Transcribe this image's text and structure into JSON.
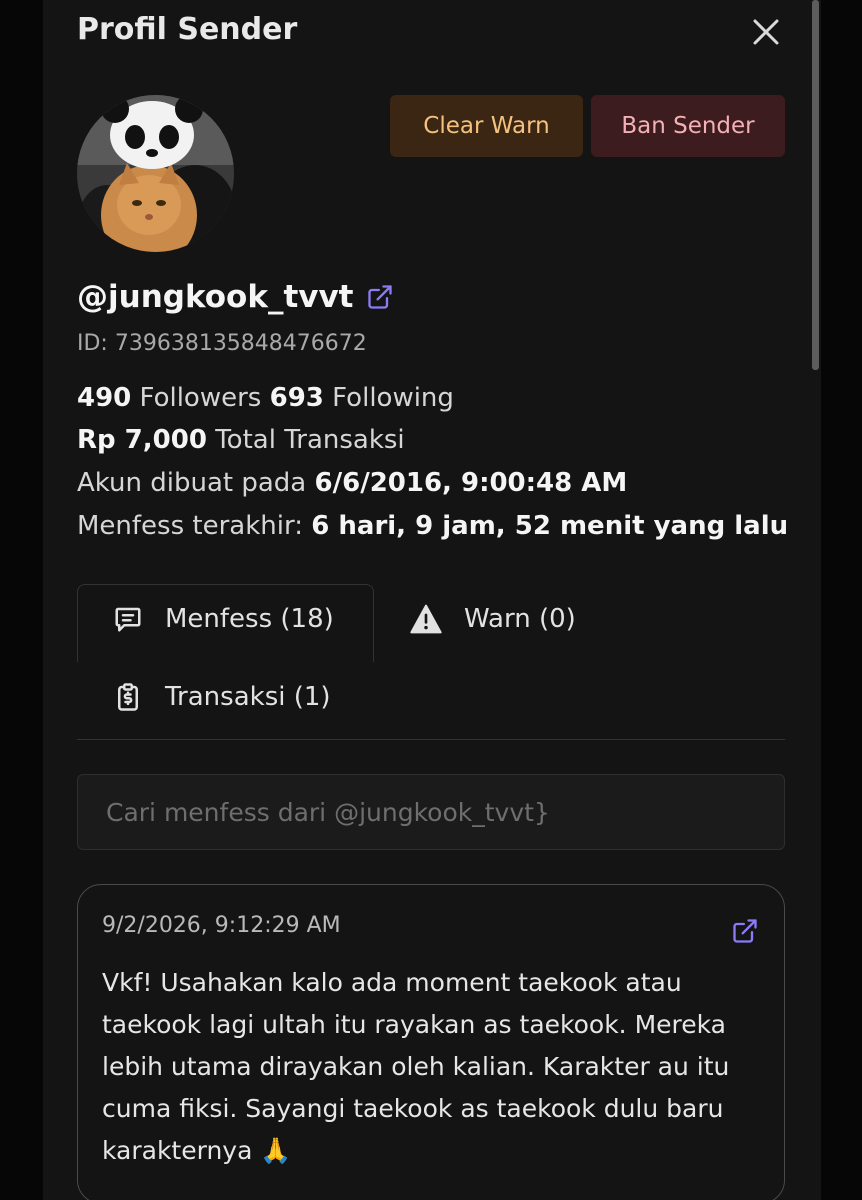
{
  "modal": {
    "title": "Profil Sender",
    "clear_warn_label": "Clear Warn",
    "ban_sender_label": "Ban Sender"
  },
  "profile": {
    "username": "@jungkook_tvvt",
    "id_text": "ID: 739638135848476672",
    "followers_count": "490",
    "followers_label": "Followers",
    "following_count": "693",
    "following_label": "Following",
    "total_amount": "Rp 7,000",
    "total_label": "Total Transaksi",
    "created_label": "Akun dibuat pada",
    "created_value": "6/6/2016, 9:00:48 AM",
    "last_label": "Menfess terakhir:",
    "last_value": "6 hari, 9 jam, 52 menit yang lalu"
  },
  "tabs": {
    "menfess": "Menfess (18)",
    "warn": "Warn (0)",
    "transaksi": "Transaksi (1)"
  },
  "search": {
    "placeholder": "Cari menfess dari @jungkook_tvvt}"
  },
  "menfess_card": {
    "timestamp": "9/2/2026, 9:12:29 AM",
    "text": "Vkf! Usahakan kalo ada moment taekook atau taekook lagi ultah itu rayakan as taekook. Mereka lebih utama dirayakan oleh kalian. Karakter au itu cuma fiksi. Sayangi taekook as taekook dulu baru karakternya 🙏"
  },
  "icons": {
    "close": "close-icon",
    "external_link": "external-link-icon",
    "menfess_tab": "chat-bubble-icon",
    "warn_tab": "warning-triangle-icon",
    "transaksi_tab": "receipt-dollar-icon"
  },
  "colors": {
    "panel_bg": "#141414",
    "clear_warn_bg": "#3a2613",
    "clear_warn_text": "#f4c27e",
    "ban_bg": "#3d1c1f",
    "ban_text": "#f3b1b5",
    "link_accent": "#8b7cf6"
  }
}
